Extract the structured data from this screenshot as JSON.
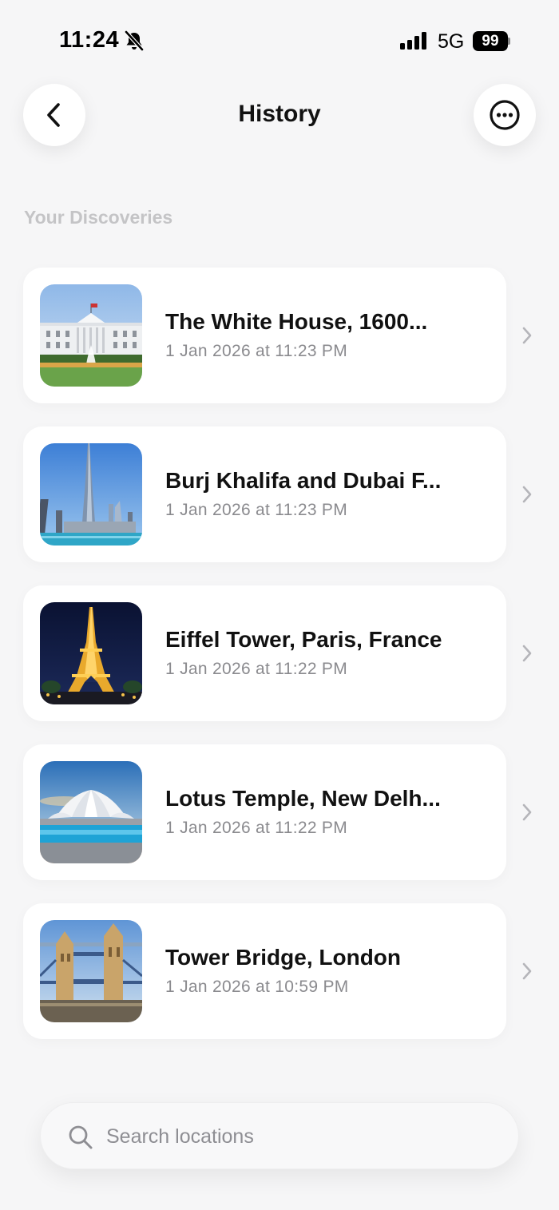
{
  "status_bar": {
    "time": "11:24",
    "network": "5G",
    "battery": "99",
    "icons": [
      "bell-slash-icon",
      "signal-icon"
    ]
  },
  "header": {
    "title": "History",
    "back_icon": "chevron-left-icon",
    "more_icon": "ellipsis-circle-icon"
  },
  "section": {
    "title": "Your Discoveries"
  },
  "items": [
    {
      "title": "The White House, 1600...",
      "date": "1 Jan 2026 at 11:23 PM",
      "thumbnail": "white-house-photo"
    },
    {
      "title": "Burj Khalifa and Dubai F...",
      "date": "1 Jan 2026 at 11:23 PM",
      "thumbnail": "burj-khalifa-photo"
    },
    {
      "title": "Eiffel Tower, Paris, France",
      "date": "1 Jan 2026 at 11:22 PM",
      "thumbnail": "eiffel-tower-photo"
    },
    {
      "title": "Lotus Temple, New Delh...",
      "date": "1 Jan 2026 at 11:22 PM",
      "thumbnail": "lotus-temple-photo"
    },
    {
      "title": "Tower Bridge, London",
      "date": "1 Jan 2026 at 10:59 PM",
      "thumbnail": "tower-bridge-photo"
    }
  ],
  "search": {
    "placeholder": "Search locations",
    "value": ""
  },
  "colors": {
    "background": "#f6f6f7",
    "card": "#ffffff",
    "secondary_text": "#8a8a8e",
    "section_text": "#c4c4c6"
  }
}
